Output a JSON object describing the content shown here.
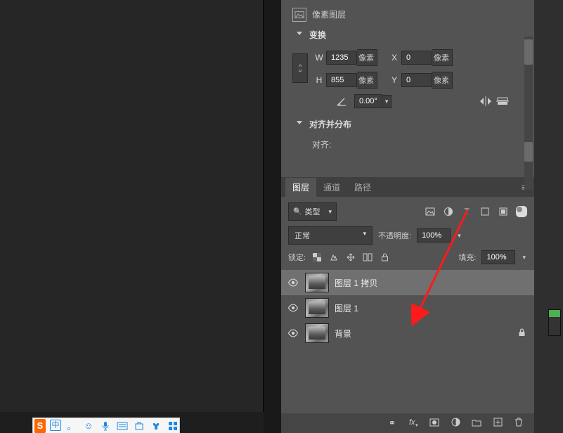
{
  "properties_panel": {
    "layer_kind": "像素图层",
    "transform": {
      "title": "变换",
      "w_label": "W",
      "w": "1235",
      "w_unit": "像素",
      "h_label": "H",
      "h": "855",
      "h_unit": "像素",
      "x_label": "X",
      "x": "0",
      "x_unit": "像素",
      "y_label": "Y",
      "y": "0",
      "y_unit": "像素",
      "angle": "0.00°"
    },
    "align": {
      "title": "对齐并分布",
      "label": "对齐:"
    }
  },
  "layers_panel": {
    "tabs": {
      "layers": "图层",
      "channels": "通道",
      "paths": "路径"
    },
    "filter_label": "类型",
    "blend_mode": "正常",
    "opacity_label": "不透明度:",
    "opacity_value": "100%",
    "lock_label": "锁定:",
    "fill_label": "填充:",
    "fill_value": "100%",
    "layers": [
      {
        "name": "图层 1 拷贝",
        "locked": false,
        "selected": true
      },
      {
        "name": "图层 1",
        "locked": false,
        "selected": false
      },
      {
        "name": "背景",
        "locked": true,
        "selected": false
      }
    ]
  },
  "ime": {
    "lang": "中",
    "punct": "。"
  }
}
